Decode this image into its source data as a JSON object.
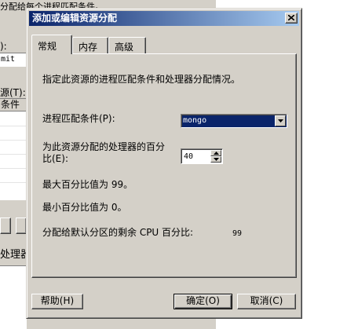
{
  "background": {
    "top_text": "分配给每个进程匹配条件。",
    "colon_fragment": "):",
    "field_fragment": "mit",
    "resource_label_fragment": "源(T):",
    "column_header_fragment": "条件",
    "processor_fragment": "处理器"
  },
  "dialog": {
    "title": "添加或编辑资源分配",
    "tabs": [
      "常规",
      "内存",
      "高级"
    ],
    "description": "指定此资源的进程匹配条件和处理器分配情况。",
    "match_label": "进程匹配条件(P):",
    "match_value": "mongo",
    "percent_label_line1": "为此资源分配的处理器的百分",
    "percent_label_line2": "比(E):",
    "percent_value": "40",
    "max_percent": "最大百分比值为 99。",
    "min_percent": "最小百分比值为 0。",
    "remaining_label": "分配给默认分区的剩余 CPU 百分比:",
    "remaining_value": "99",
    "buttons": {
      "help": "帮助(H)",
      "ok": "确定(O)",
      "cancel": "取消(C)"
    }
  }
}
